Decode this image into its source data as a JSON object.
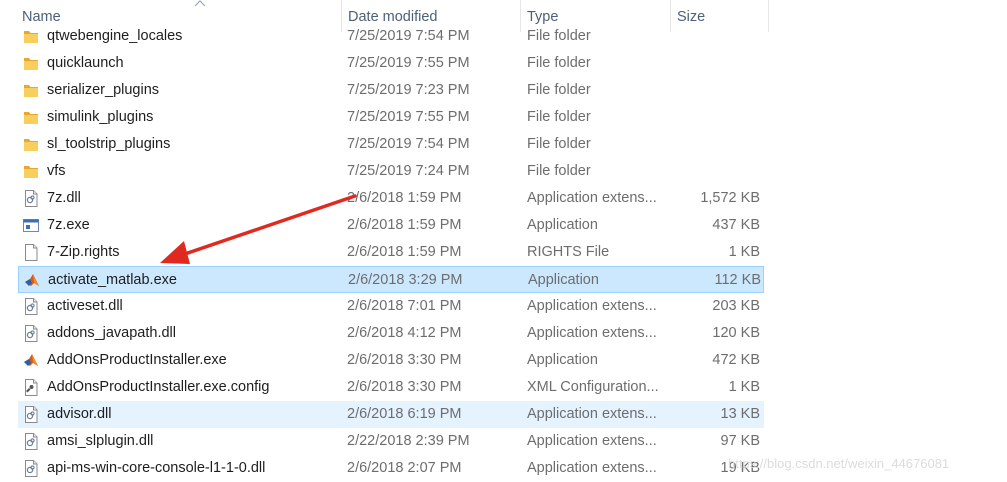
{
  "columns": {
    "name": "Name",
    "date": "Date modified",
    "type": "Type",
    "size": "Size"
  },
  "rows": [
    {
      "name": "qtwebengine_locales",
      "date": "7/25/2019 7:54 PM",
      "type": "File folder",
      "size": "",
      "icon": "folder-icon"
    },
    {
      "name": "quicklaunch",
      "date": "7/25/2019 7:55 PM",
      "type": "File folder",
      "size": "",
      "icon": "folder-icon"
    },
    {
      "name": "serializer_plugins",
      "date": "7/25/2019 7:23 PM",
      "type": "File folder",
      "size": "",
      "icon": "folder-icon"
    },
    {
      "name": "simulink_plugins",
      "date": "7/25/2019 7:55 PM",
      "type": "File folder",
      "size": "",
      "icon": "folder-icon"
    },
    {
      "name": "sl_toolstrip_plugins",
      "date": "7/25/2019 7:54 PM",
      "type": "File folder",
      "size": "",
      "icon": "folder-icon"
    },
    {
      "name": "vfs",
      "date": "7/25/2019 7:24 PM",
      "type": "File folder",
      "size": "",
      "icon": "folder-icon"
    },
    {
      "name": "7z.dll",
      "date": "2/6/2018 1:59 PM",
      "type": "Application extens...",
      "size": "1,572 KB",
      "icon": "dll-icon"
    },
    {
      "name": "7z.exe",
      "date": "2/6/2018 1:59 PM",
      "type": "Application",
      "size": "437 KB",
      "icon": "exe-icon"
    },
    {
      "name": "7-Zip.rights",
      "date": "2/6/2018 1:59 PM",
      "type": "RIGHTS File",
      "size": "1 KB",
      "icon": "file-icon"
    },
    {
      "name": "activate_matlab.exe",
      "date": "2/6/2018 3:29 PM",
      "type": "Application",
      "size": "112 KB",
      "icon": "matlab-icon",
      "state": "selected"
    },
    {
      "name": "activeset.dll",
      "date": "2/6/2018 7:01 PM",
      "type": "Application extens...",
      "size": "203 KB",
      "icon": "dll-icon"
    },
    {
      "name": "addons_javapath.dll",
      "date": "2/6/2018 4:12 PM",
      "type": "Application extens...",
      "size": "120 KB",
      "icon": "dll-icon"
    },
    {
      "name": "AddOnsProductInstaller.exe",
      "date": "2/6/2018 3:30 PM",
      "type": "Application",
      "size": "472 KB",
      "icon": "matlab-icon"
    },
    {
      "name": "AddOnsProductInstaller.exe.config",
      "date": "2/6/2018 3:30 PM",
      "type": "XML Configuration...",
      "size": "1 KB",
      "icon": "config-icon"
    },
    {
      "name": "advisor.dll",
      "date": "2/6/2018 6:19 PM",
      "type": "Application extens...",
      "size": "13 KB",
      "icon": "dll-icon",
      "state": "hover"
    },
    {
      "name": "amsi_slplugin.dll",
      "date": "2/22/2018 2:39 PM",
      "type": "Application extens...",
      "size": "97 KB",
      "icon": "dll-icon"
    },
    {
      "name": "api-ms-win-core-console-l1-1-0.dll",
      "date": "2/6/2018 2:07 PM",
      "type": "Application extens...",
      "size": "19 KB",
      "icon": "dll-icon"
    }
  ],
  "watermark": "https://blog.csdn.net/weixin_44676081",
  "colors": {
    "selected_bg": "#cce8ff",
    "selected_border": "#99d1ff",
    "hover_bg": "#e5f3ff",
    "folder": "#f4c152",
    "arrow": "#e02a1f",
    "header_text": "#4c607a"
  }
}
